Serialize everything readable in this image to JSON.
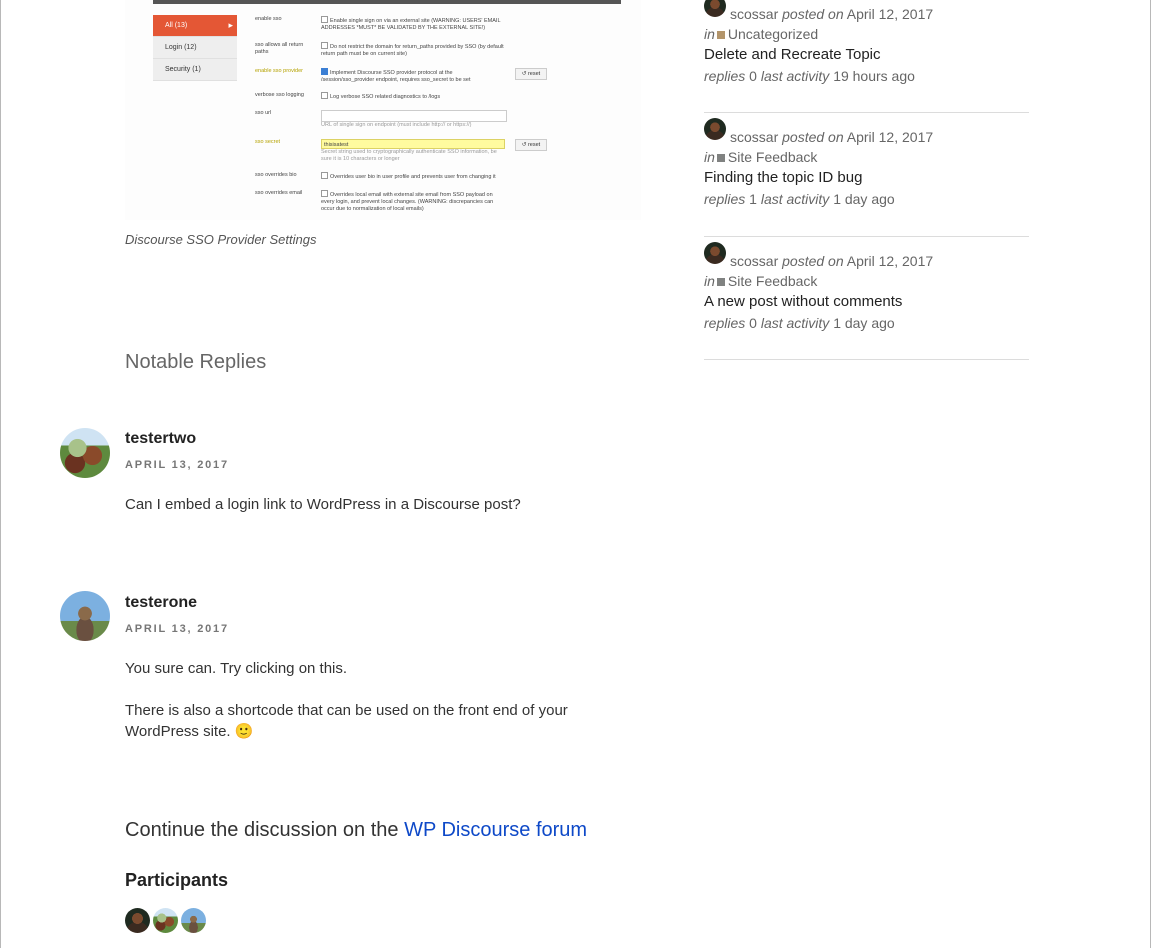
{
  "settings_shot": {
    "menu": [
      {
        "label": "All (13)",
        "active": true
      },
      {
        "label": "Login (12)",
        "active": false
      },
      {
        "label": "Security (1)",
        "active": false
      }
    ],
    "rows": [
      {
        "label": "enable sso",
        "value": "Enable single sign on via an external site (WARNING: USERS' EMAIL ADDRESSES *MUST* BE VALIDATED BY THE EXTERNAL SITE!)"
      },
      {
        "label": "sso allows all return paths",
        "value": "Do not restrict the domain for return_paths provided by SSO (by default return path must be on current site)"
      },
      {
        "label": "enable sso provider",
        "value": "Implement Discourse SSO provider protocol at the /session/sso_provider endpoint, requires sso_secret to be set",
        "reset": "reset"
      },
      {
        "label": "verbose sso logging",
        "value": "Log verbose SSO related diagnostics to /logs"
      },
      {
        "label": "sso url",
        "hint": "URL of single sign on endpoint (must include http:// or https://)"
      },
      {
        "label": "sso secret",
        "value": "thisisatest",
        "hint": "Secret string used to cryptographically authenticate SSO information, be sure it is 10 characters or longer",
        "reset": "reset"
      },
      {
        "label": "sso overrides bio",
        "value": "Overrides user bio in user profile and prevents user from changing it"
      },
      {
        "label": "sso overrides email",
        "value": "Overrides local email with external site email from SSO payload on every login, and prevent local changes. (WARNING: discrepancies can occur due to normalization of local emails)"
      }
    ]
  },
  "caption": "Discourse SSO Provider Settings",
  "notable_heading": "Notable Replies",
  "replies": [
    {
      "author": "testertwo",
      "date": "APRIL 13, 2017",
      "paragraphs": [
        "Can I embed a login link to WordPress in a Discourse post?"
      ]
    },
    {
      "author": "testerone",
      "date": "APRIL 13, 2017",
      "paragraphs": [
        "You sure can. Try clicking on this.",
        "There is also a shortcode that can be used on the front end of your WordPress site. 🙂"
      ]
    }
  ],
  "continue": {
    "prefix": "Continue the discussion on the ",
    "link": "WP Discourse forum"
  },
  "participants_heading": "Participants",
  "sidebar": {
    "topics": [
      {
        "user": "scossar",
        "posted_on": "posted on",
        "date": "April 12, 2017",
        "in": "in",
        "category": "Uncategorized",
        "category_color": "#b3956b",
        "title": "Delete and Recreate Topic",
        "replies_label": "replies",
        "replies": "0",
        "last_activity_label": "last activity",
        "last_activity": "19 hours ago"
      },
      {
        "user": "scossar",
        "posted_on": "posted on",
        "date": "April 12, 2017",
        "in": "in",
        "category": "Site Feedback",
        "category_color": "#808281",
        "title": "Finding the topic ID bug",
        "replies_label": "replies",
        "replies": "1",
        "last_activity_label": "last activity",
        "last_activity": "1 day ago"
      },
      {
        "user": "scossar",
        "posted_on": "posted on",
        "date": "April 12, 2017",
        "in": "in",
        "category": "Site Feedback",
        "category_color": "#808281",
        "title": "A new post without comments",
        "replies_label": "replies",
        "replies": "0",
        "last_activity_label": "last activity",
        "last_activity": "1 day ago"
      }
    ]
  }
}
